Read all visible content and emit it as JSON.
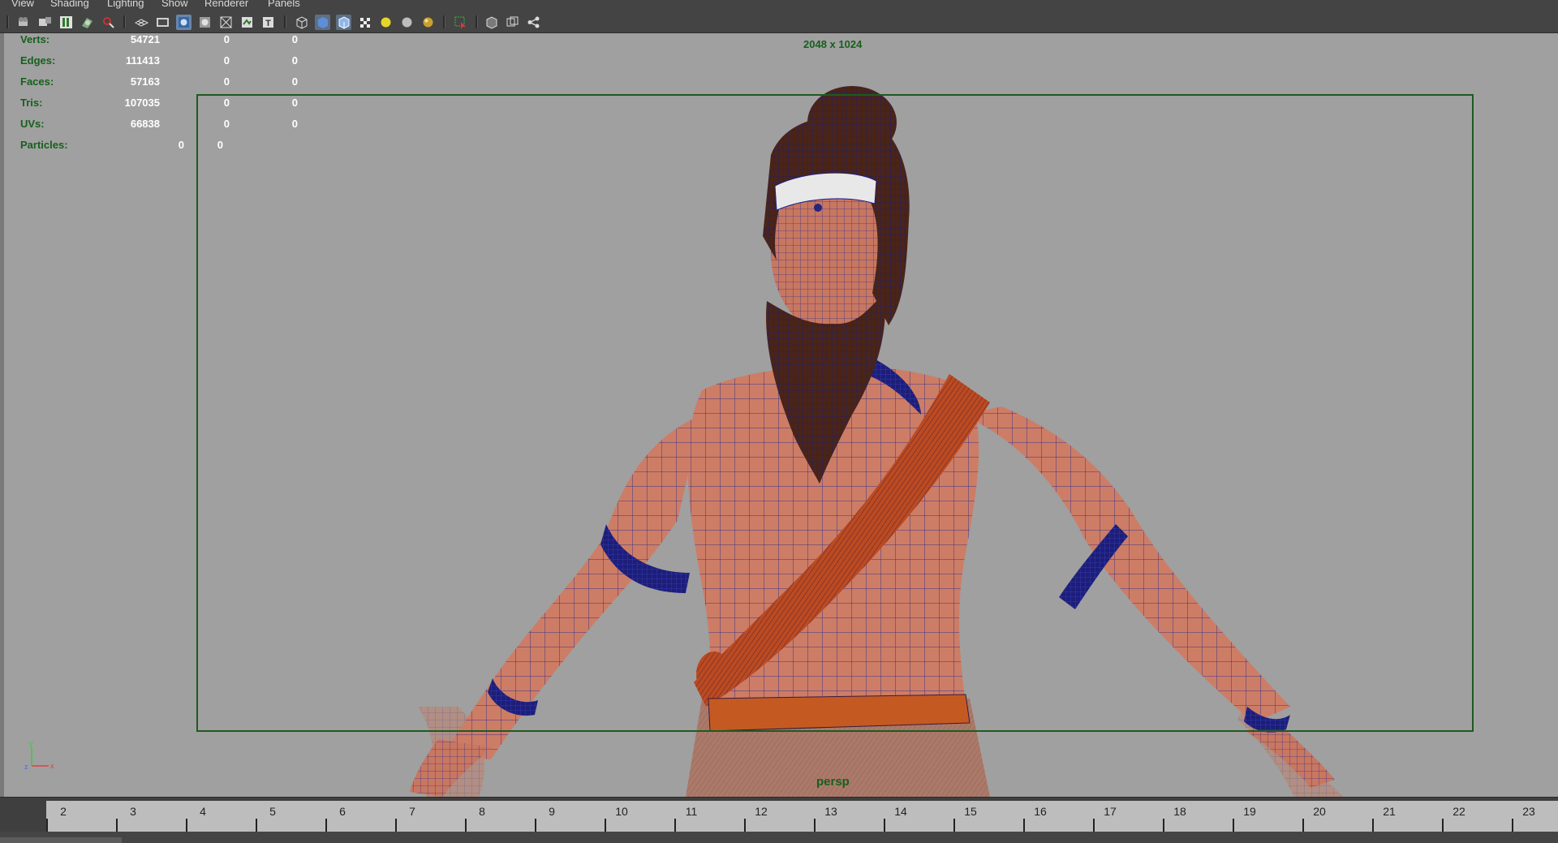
{
  "menu": {
    "items": [
      "View",
      "Shading",
      "Lighting",
      "Show",
      "Renderer",
      "Panels"
    ]
  },
  "toolbar": {
    "icons": [
      "select-camera-icon",
      "camera-attributes-icon",
      "bookmarks-icon",
      "image-plane-icon",
      "2d-pan-zoom-icon",
      "grid-icon",
      "film-gate-icon",
      "resolution-gate-icon",
      "gate-mask-icon",
      "field-chart-icon",
      "safe-action-icon",
      "safe-title-icon",
      "wireframe-icon",
      "smooth-shade-icon",
      "wireframe-on-shaded-icon",
      "textured-icon",
      "use-all-lights-icon",
      "shadows-icon",
      "ambient-occlusion-icon",
      "isolate-select-icon",
      "xray-icon",
      "xray-joints-icon",
      "share-icon"
    ]
  },
  "hud": {
    "rows": [
      {
        "label": "Verts:",
        "v1": "54721",
        "v2": "0",
        "v3": "0"
      },
      {
        "label": "Edges:",
        "v1": "111413",
        "v2": "0",
        "v3": "0"
      },
      {
        "label": "Faces:",
        "v1": "57163",
        "v2": "0",
        "v3": "0"
      },
      {
        "label": "Tris:",
        "v1": "107035",
        "v2": "0",
        "v3": "0"
      },
      {
        "label": "UVs:",
        "v1": "66838",
        "v2": "0",
        "v3": "0"
      },
      {
        "label": "Particles:",
        "v1": "0",
        "v2": "0",
        "v3": ""
      }
    ],
    "resolution": "2048 x 1024",
    "camera": "persp"
  },
  "axis": {
    "y": "y",
    "z": "z",
    "x": "x"
  },
  "timeline": {
    "frames": [
      "2",
      "3",
      "4",
      "5",
      "6",
      "7",
      "8",
      "9",
      "10",
      "11",
      "12",
      "13",
      "14",
      "15",
      "16",
      "17",
      "18",
      "19",
      "20",
      "21",
      "22",
      "23"
    ]
  },
  "colors": {
    "hud_label": "#16601c",
    "gate": "#1e5a20",
    "skin": "#cc7a64",
    "wire": "#1d1f8c",
    "cloth": "#b4441c",
    "hair": "#3b1c14"
  }
}
